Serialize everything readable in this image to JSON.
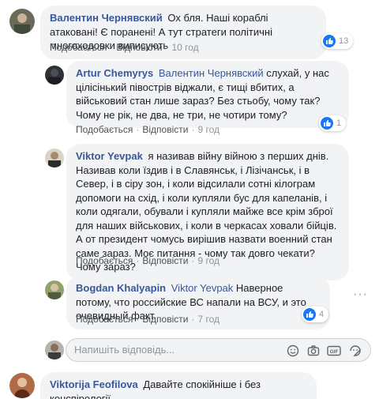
{
  "comments": [
    {
      "author": "Валентин Чернявский",
      "text": "Ох бля. Наші кораблі атаковані! Є поранені! А тут стратеги політичні многоходовки виписують",
      "like_label": "Подобається",
      "reply_label": "Відповісти",
      "time": "10 год",
      "reactions": "13"
    },
    {
      "author": "Artur Chemyrys",
      "mention": "Валентин Чернявский",
      "text": "слухай, у нас цілісінький півострів віджали, є тищі вбитих, а військовий стан лише зараз? Без стьобу, чому так? Чому не рік, не два, не три, не чотири тому?",
      "like_label": "Подобається",
      "reply_label": "Відповісти",
      "time": "9 год",
      "reactions": "1"
    },
    {
      "author": "Viktor Yevpak",
      "text": "я називав війну війною з перших днів. Називав коли їздив і в Славянськ, і Лізічанськ, і в Север, і в сіру зон, і коли відсилали сотні кілограм допомоги на схід, і коли купляли бус для капеланів, і коли одягали, обували і купляли майже все крім зброї для наших військових, і коли в черкасах ховали бійців. А от президент чомусь вирішив назвати военний стан саме зараз. Моє питання - чому так довго чекати? Чому зараз?",
      "like_label": "Подобається",
      "reply_label": "Відповісти",
      "time": "9 год"
    },
    {
      "author": "Bogdan Khalyapin",
      "mention": "Viktor Yevpak",
      "text": "Наверное потому, что российские ВС напали на ВСУ, и это очевидный факт.",
      "like_label": "Подобається",
      "reply_label": "Відповісти",
      "time": "7 год",
      "reactions": "4"
    },
    {
      "author": "Viktorija Feofilova",
      "text": "Давайте спокійніше і без конспірології."
    }
  ],
  "reply_box": {
    "placeholder": "Напишіть відповідь..."
  },
  "colors": {
    "link": "#385898",
    "bubble": "#f2f3f5",
    "meta": "#90949c",
    "like": "#1877f2"
  },
  "icons": [
    "like-icon",
    "emoji-icon",
    "camera-icon",
    "gif-icon",
    "sticker-icon",
    "more-options-icon"
  ]
}
